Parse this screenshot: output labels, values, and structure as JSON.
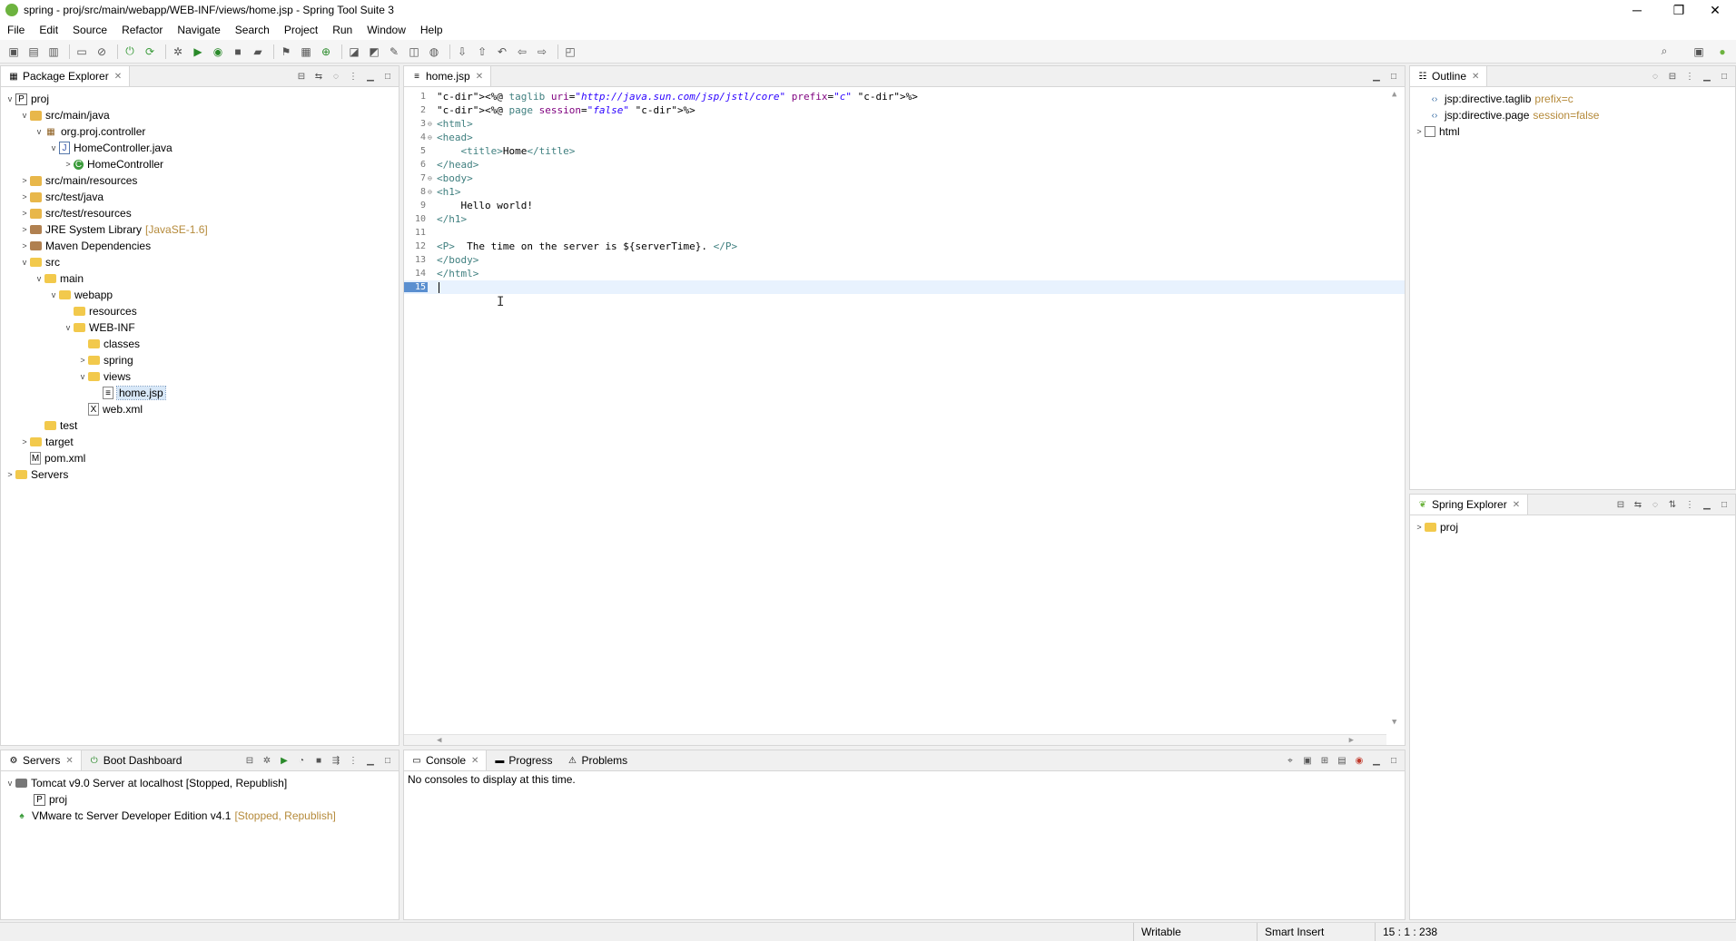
{
  "window": {
    "title": "spring - proj/src/main/webapp/WEB-INF/views/home.jsp - Spring Tool Suite 3",
    "minimize": "─",
    "restore": "❐",
    "close": "✕"
  },
  "menu": [
    "File",
    "Edit",
    "Source",
    "Refactor",
    "Navigate",
    "Search",
    "Project",
    "Run",
    "Window",
    "Help"
  ],
  "package_explorer": {
    "title": "Package Explorer",
    "tree": [
      {
        "label": "proj",
        "arrow": "v",
        "icon": "project-icon"
      },
      {
        "label": "src/main/java",
        "arrow": "v",
        "icon": "source-folder-icon"
      },
      {
        "label": "org.proj.controller",
        "arrow": "v",
        "icon": "package-icon"
      },
      {
        "label": "HomeController.java",
        "arrow": "v",
        "icon": "java-file-icon"
      },
      {
        "label": "HomeController",
        "arrow": ">",
        "icon": "class-icon"
      },
      {
        "label": "src/main/resources",
        "arrow": ">",
        "icon": "source-folder-icon"
      },
      {
        "label": "src/test/java",
        "arrow": ">",
        "icon": "source-folder-icon"
      },
      {
        "label": "src/test/resources",
        "arrow": ">",
        "icon": "source-folder-icon"
      },
      {
        "label": "JRE System Library",
        "suffix": "[JavaSE-1.6]",
        "arrow": ">",
        "icon": "library-icon"
      },
      {
        "label": "Maven Dependencies",
        "arrow": ">",
        "icon": "library-icon"
      },
      {
        "label": "src",
        "arrow": "v",
        "icon": "folder-icon"
      },
      {
        "label": "main",
        "arrow": "v",
        "icon": "folder-icon"
      },
      {
        "label": "webapp",
        "arrow": "v",
        "icon": "folder-icon"
      },
      {
        "label": "resources",
        "arrow": "",
        "icon": "folder-icon"
      },
      {
        "label": "WEB-INF",
        "arrow": "v",
        "icon": "folder-icon"
      },
      {
        "label": "classes",
        "arrow": "",
        "icon": "folder-icon"
      },
      {
        "label": "spring",
        "arrow": ">",
        "icon": "folder-icon"
      },
      {
        "label": "views",
        "arrow": "v",
        "icon": "folder-icon"
      },
      {
        "label": "home.jsp",
        "arrow": "",
        "icon": "jsp-file-icon"
      },
      {
        "label": "web.xml",
        "arrow": "",
        "icon": "xml-file-icon"
      },
      {
        "label": "test",
        "arrow": "",
        "icon": "folder-icon"
      },
      {
        "label": "target",
        "arrow": ">",
        "icon": "folder-icon"
      },
      {
        "label": "pom.xml",
        "arrow": "",
        "icon": "xml-file-icon"
      },
      {
        "label": "Servers",
        "arrow": ">",
        "icon": "server-folder-icon"
      }
    ]
  },
  "editor": {
    "tab": "home.jsp",
    "lines": [
      {
        "n": "1",
        "fold": "",
        "html": "<%@ taglib uri=\"http://java.sun.com/jsp/jstl/core\" prefix=\"c\" %>"
      },
      {
        "n": "2",
        "fold": "",
        "html": "<%@ page session=\"false\" %>"
      },
      {
        "n": "3",
        "fold": "⊖",
        "html": "<html>"
      },
      {
        "n": "4",
        "fold": "⊖",
        "html": "<head>"
      },
      {
        "n": "5",
        "fold": "",
        "html": "    <title>Home</title>"
      },
      {
        "n": "6",
        "fold": "",
        "html": "</head>"
      },
      {
        "n": "7",
        "fold": "⊖",
        "html": "<body>"
      },
      {
        "n": "8",
        "fold": "⊖",
        "html": "<h1>"
      },
      {
        "n": "9",
        "fold": "",
        "html": "    Hello world!"
      },
      {
        "n": "10",
        "fold": "",
        "html": "</h1>"
      },
      {
        "n": "11",
        "fold": "",
        "html": ""
      },
      {
        "n": "12",
        "fold": "",
        "html": "<P>  The time on the server is ${serverTime}. </P>"
      },
      {
        "n": "13",
        "fold": "",
        "html": "</body>"
      },
      {
        "n": "14",
        "fold": "",
        "html": "</html>"
      },
      {
        "n": "15",
        "fold": "",
        "html": ""
      }
    ]
  },
  "outline": {
    "title": "Outline",
    "items": [
      {
        "label": "jsp:directive.taglib",
        "suffix": "prefix=c"
      },
      {
        "label": "jsp:directive.page",
        "suffix": "session=false"
      },
      {
        "label": "html",
        "suffix": ""
      }
    ]
  },
  "spring_explorer": {
    "title": "Spring Explorer",
    "items": [
      {
        "label": "proj"
      }
    ]
  },
  "servers_panel": {
    "tabs": [
      "Servers",
      "Boot Dashboard"
    ],
    "items": [
      {
        "label": "Tomcat v9.0 Server at localhost  [Stopped, Republish]",
        "suffix": ""
      },
      {
        "label": "proj",
        "suffix": ""
      },
      {
        "label": "VMware tc Server Developer Edition v4.1",
        "suffix": "[Stopped, Republish]"
      }
    ]
  },
  "console_panel": {
    "tabs": [
      "Console",
      "Progress",
      "Problems"
    ],
    "message": "No consoles to display at this time."
  },
  "status": {
    "writable": "Writable",
    "insert_mode": "Smart Insert",
    "position": "15 : 1 : 238"
  }
}
